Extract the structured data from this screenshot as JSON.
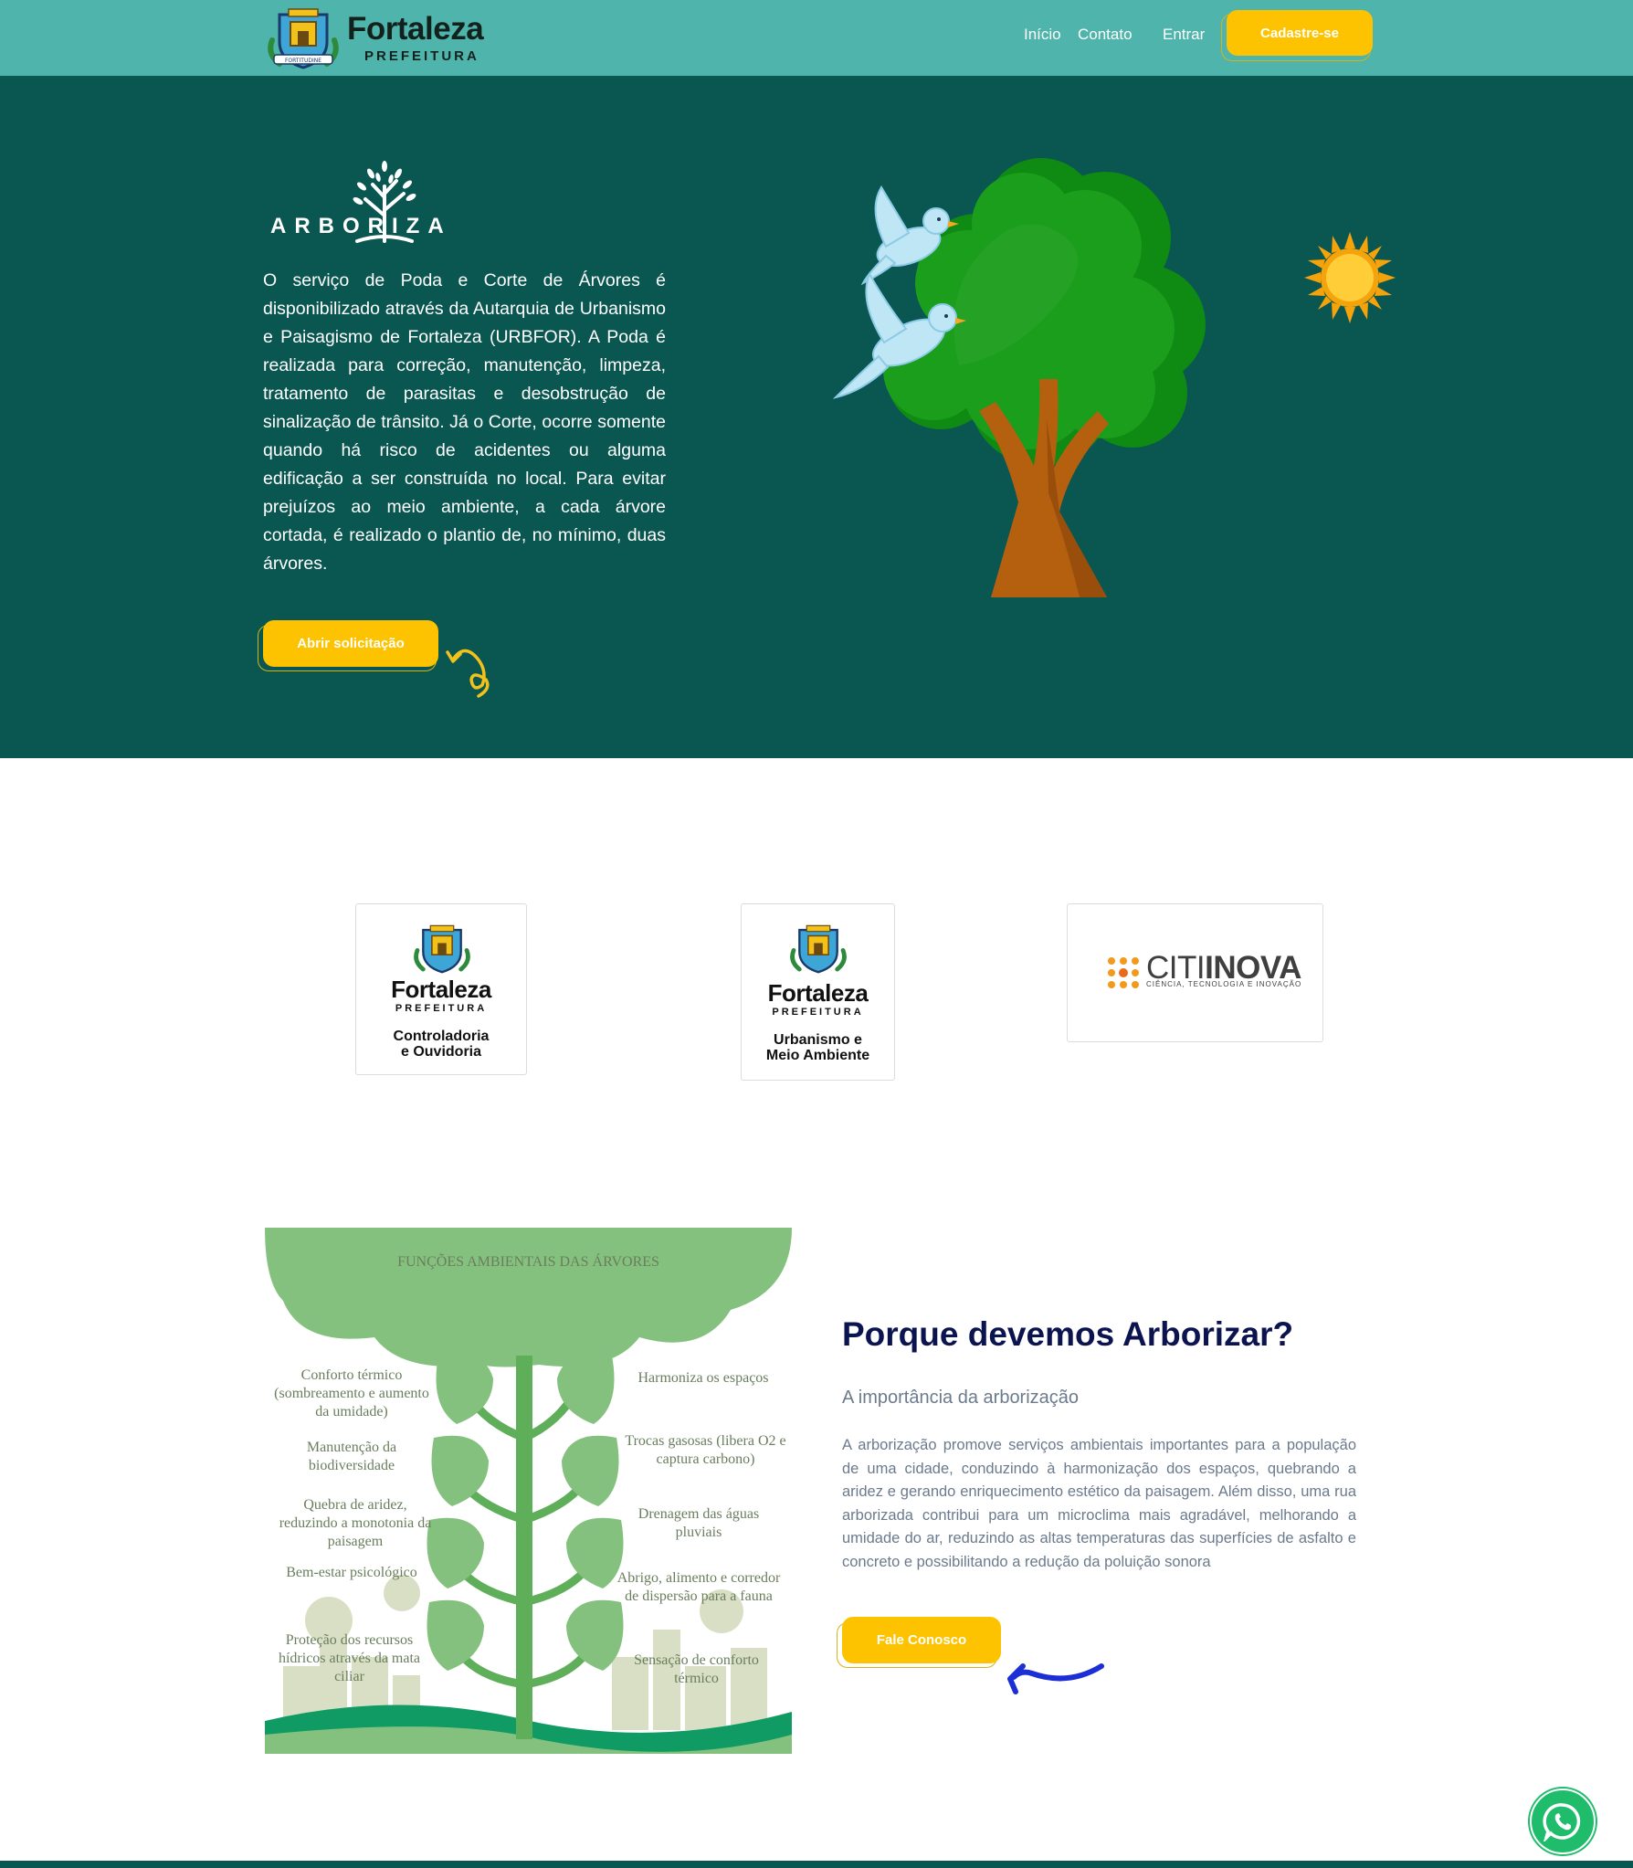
{
  "header": {
    "logo_word": "Fortaleza",
    "logo_sub": "PREFEITURA",
    "logo_motto": "FORTITUDINE",
    "nav": [
      "Início",
      "Contato",
      "Entrar"
    ],
    "signup_label": "Cadastre-se"
  },
  "hero": {
    "logo_text": "ARBORIZA",
    "description": "O serviço de Poda e Corte de Árvores é disponibilizado através da Autarquia de Urbanismo e Paisagismo de Fortaleza (URBFOR). A Poda é realizada para correção, manutenção, limpeza, tratamento de parasitas e desobstrução de sinalização de trânsito. Já o Corte, ocorre somente quando há risco de acidentes ou alguma edificação a ser construída no local. Para evitar prejuízos ao meio ambiente, a cada árvore cortada, é realizado o plantio de, no mínimo, duas árvores.",
    "cta_label": "Abrir solicitação"
  },
  "partners": [
    {
      "word": "Fortaleza",
      "sub": "PREFEITURA",
      "dept": [
        "Controladoria",
        "e Ouvidoria"
      ]
    },
    {
      "word": "Fortaleza",
      "sub": "PREFEITURA",
      "dept": [
        "Urbanismo e",
        "Meio Ambiente"
      ]
    },
    {
      "brand_light": "CITI",
      "brand_bold": "INOVA",
      "tagline": "CIÊNCIA, TECNOLOGIA E INOVAÇÃO"
    }
  ],
  "infographic": {
    "title": "FUNÇÕES AMBIENTAIS DAS ÁRVORES",
    "left": [
      "Conforto térmico (sombreamento e aumento da umidade)",
      "Manutenção da biodiversidade",
      "Quebra de aridez, reduzindo a monotonia da paisagem",
      "Bem-estar psicológico",
      "Proteção dos recursos hídricos através da mata ciliar"
    ],
    "right": [
      "Harmoniza os espaços",
      "Trocas gasosas (libera O2 e captura carbono)",
      "Drenagem das águas pluviais",
      "Abrigo, alimento e corredor de dispersão para a fauna",
      "Sensação de conforto térmico"
    ]
  },
  "why": {
    "title": "Porque devemos Arborizar?",
    "subtitle": "A importância da arborização",
    "text": "A arborização promove serviços ambientais importantes para a população de uma cidade, conduzindo à harmonização dos espaços, quebrando a aridez e gerando enriquecimento estético da paisagem. Além disso, uma rua arborizada contribui para um microclima mais agradável, melhorando a umidade do ar, reduzindo as altas temperaturas das superfícies de asfalto e concreto e possibilitando a redução da poluição sonora",
    "cta_label": "Fale Conosco"
  },
  "colors": {
    "topbar": "#4fb5ac",
    "hero_bg": "#0a5651",
    "accent": "#fdc300",
    "title_navy": "#0c1450",
    "body_gray": "#6b7a8c",
    "whatsapp": "#1fbc6c"
  }
}
